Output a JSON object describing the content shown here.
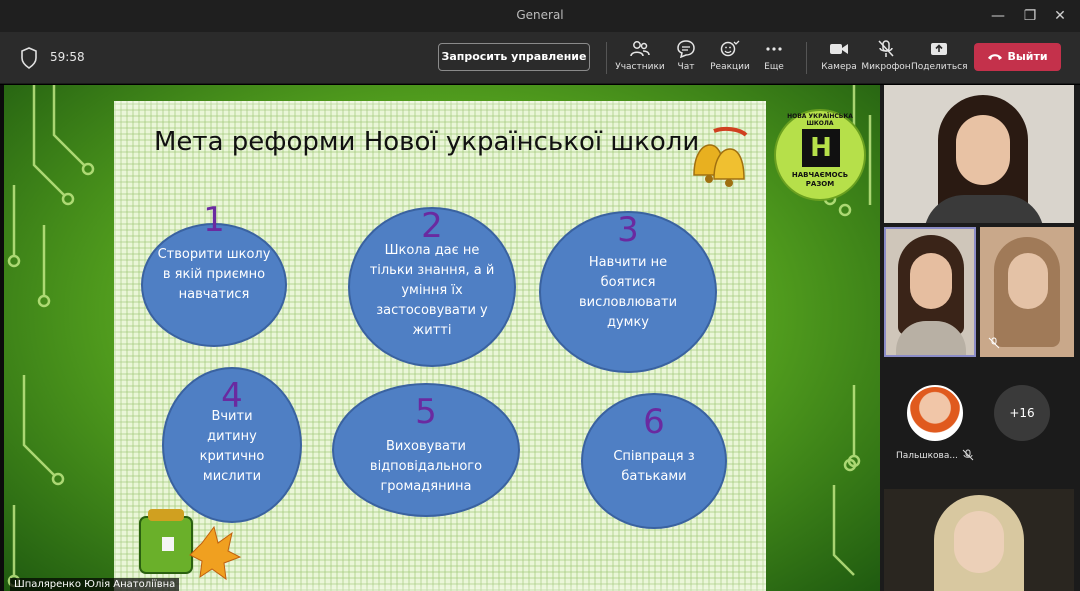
{
  "window": {
    "title": "General"
  },
  "toolbar": {
    "timer": "59:58",
    "request_control": "Запросить управление",
    "participants": "Участники",
    "chat": "Чат",
    "reactions": "Реакции",
    "more": "Еще",
    "camera": "Камера",
    "microphone": "Микрофон",
    "share": "Поделиться",
    "leave": "Выйти",
    "leave_color": "#c4314b"
  },
  "slide": {
    "title": "Мета реформи Нової української школи",
    "logo": {
      "ring_text": "НОВА УКРАЇНСЬКА ШКОЛА",
      "letter": "Н",
      "motto_line1": "НАВЧАЄМОСЬ",
      "motto_line2": "РАЗОМ"
    },
    "goals": [
      {
        "num": "1",
        "text": "Створити школу в якій приємно навчатися"
      },
      {
        "num": "2",
        "text": "Школа дає не тільки знання, а й уміння їх застосовувати у житті"
      },
      {
        "num": "3",
        "text": "Навчити не боятися висловлювати думку"
      },
      {
        "num": "4",
        "text": "Вчити дитину критично мислити"
      },
      {
        "num": "5",
        "text": "Виховувати відповідального громадянина"
      },
      {
        "num": "6",
        "text": "Співпраця з батьками"
      }
    ],
    "circle_color": "#4f7fc4"
  },
  "presenter": {
    "name": "Шпаляренко Юлія Анатоліївна"
  },
  "gallery": {
    "named_participant": "Пальшкова...",
    "more_count": "+16"
  }
}
